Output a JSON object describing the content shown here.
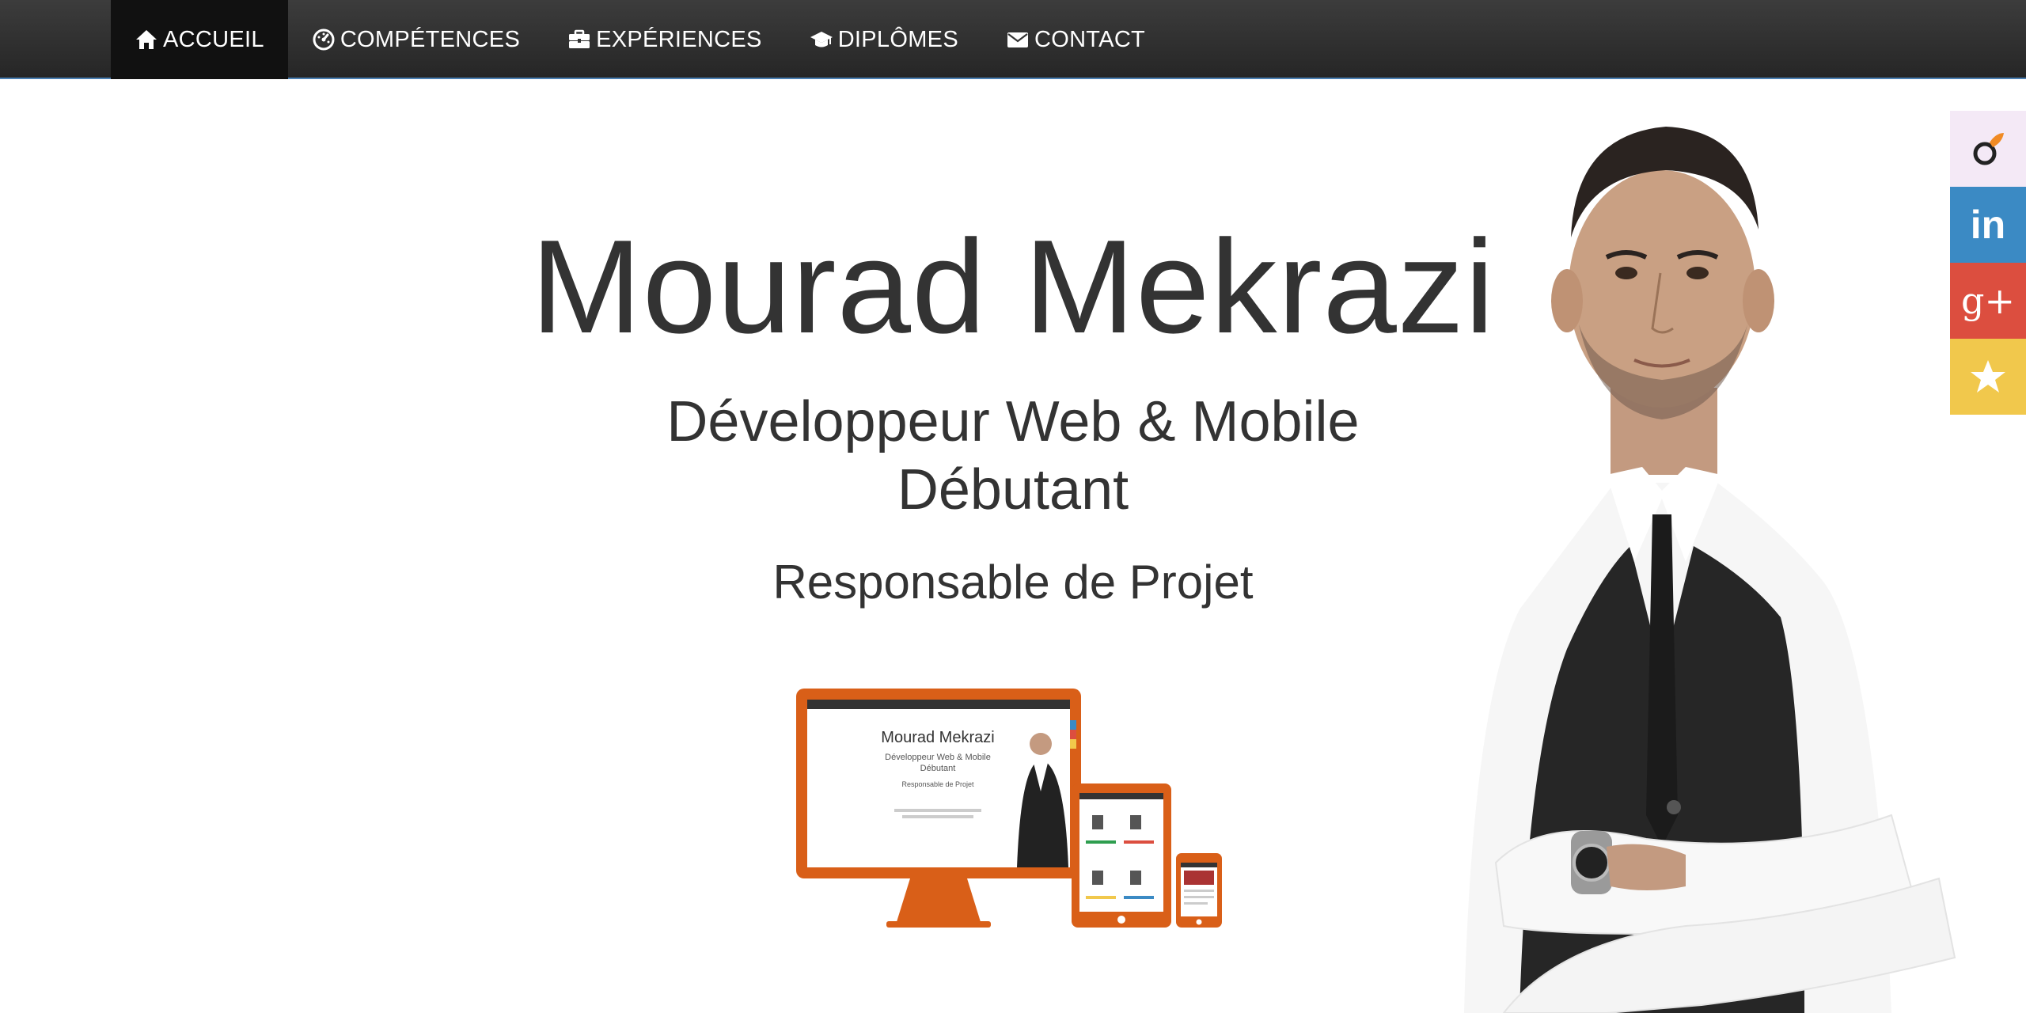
{
  "nav": {
    "items": [
      {
        "label": "ACCUEIL",
        "icon": "home-icon",
        "active": true
      },
      {
        "label": "COMPÉTENCES",
        "icon": "dashboard-icon",
        "active": false
      },
      {
        "label": "EXPÉRIENCES",
        "icon": "briefcase-icon",
        "active": false
      },
      {
        "label": "DIPLÔMES",
        "icon": "graduation-cap-icon",
        "active": false
      },
      {
        "label": "CONTACT",
        "icon": "envelope-icon",
        "active": false
      }
    ]
  },
  "hero": {
    "name": "Mourad Mekrazi",
    "subtitle_line1": "Développeur Web & Mobile",
    "subtitle_line2": "Débutant",
    "role": "Responsable de Projet"
  },
  "mockup": {
    "screen_name": "Mourad Mekrazi",
    "screen_sub1": "Développeur Web & Mobile",
    "screen_sub2": "Débutant",
    "screen_role": "Responsable de Projet",
    "accent_color": "#d95f18"
  },
  "social": {
    "items": [
      {
        "name": "viadeo",
        "icon": "viadeo-icon",
        "color": "#f4e9f6"
      },
      {
        "name": "linkedin",
        "icon": "linkedin-icon",
        "color": "#3b8ac4",
        "glyph": "in"
      },
      {
        "name": "google-plus",
        "icon": "google-plus-icon",
        "color": "#dc4e3f",
        "glyph": "g+"
      },
      {
        "name": "favorite",
        "icon": "star-icon",
        "color": "#f1c84c"
      }
    ]
  },
  "colors": {
    "navbar": "#2e2e2e",
    "navbar_active": "#111111",
    "nav_border": "#4a7fb3",
    "text": "#333333"
  }
}
